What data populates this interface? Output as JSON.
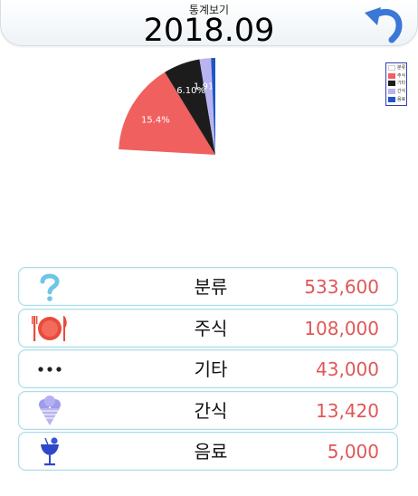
{
  "header": {
    "subtitle": "통계보기",
    "title": "2018.09",
    "back_icon": "undo-arrow-icon"
  },
  "chart_data": {
    "type": "pie",
    "slices": [
      {
        "name": "분류",
        "value": 533600,
        "color": "#ffffff",
        "label": ""
      },
      {
        "name": "주식",
        "value": 108000,
        "color": "#f0605e",
        "label": "15.4%"
      },
      {
        "name": "기타",
        "value": 43000,
        "color": "#1c1c1c",
        "label": "6.10%"
      },
      {
        "name": "간식",
        "value": 13420,
        "color": "#b8b4f0",
        "label": "1.91%"
      },
      {
        "name": "음료",
        "value": 5000,
        "color": "#1f55c6",
        "label": ""
      }
    ],
    "legend_position": "top-right"
  },
  "legend": {
    "items": [
      {
        "label": "분류",
        "color": "#ffffff"
      },
      {
        "label": "주식",
        "color": "#f0605e"
      },
      {
        "label": "기타",
        "color": "#1c1c1c"
      },
      {
        "label": "간식",
        "color": "#b8b4f0"
      },
      {
        "label": "음료",
        "color": "#1f55c6"
      }
    ]
  },
  "rows": [
    {
      "label": "분류",
      "value": "533,600",
      "icon": "question-mark-icon"
    },
    {
      "label": "주식",
      "value": "108,000",
      "icon": "plate-fork-knife-icon"
    },
    {
      "label": "기타",
      "value": "43,000",
      "icon": "ellipsis-dots-icon"
    },
    {
      "label": "간식",
      "value": "13,420",
      "icon": "ice-cream-cone-icon"
    },
    {
      "label": "음료",
      "value": "5,000",
      "icon": "cocktail-glass-icon"
    }
  ]
}
